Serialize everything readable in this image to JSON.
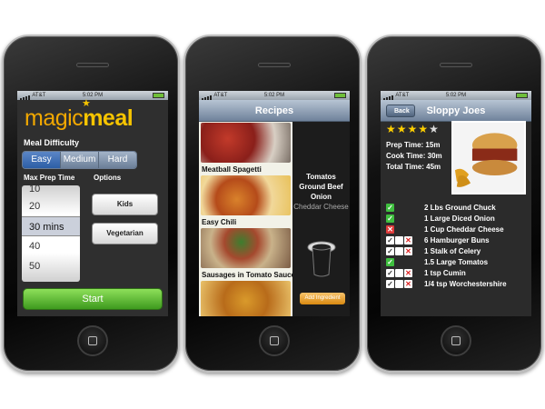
{
  "status": {
    "carrier": "AT&T",
    "time": "5:02 PM"
  },
  "screen1": {
    "logo_part1": "magic",
    "logo_part2": "meal",
    "difficulty_label": "Meal Difficulty",
    "difficulty_options": [
      "Easy",
      "Medium",
      "Hard"
    ],
    "difficulty_selected": "Easy",
    "prep_label": "Max Prep Time",
    "prep_values": [
      "10",
      "20",
      "30 mins",
      "40",
      "50"
    ],
    "prep_selected": "30 mins",
    "options_label": "Options",
    "option_kids": "Kids",
    "option_vegetarian": "Vegetarian",
    "start_label": "Start"
  },
  "screen2": {
    "title": "Recipes",
    "recipes": [
      "Meatball Spagetti",
      "Easy Chili",
      "Sausages in Tomato Sauce",
      ""
    ],
    "ingredients": [
      "Tomatos",
      "Ground Beef",
      "Onion",
      "Cheddar Cheese"
    ],
    "add_button": "Add Ingredient"
  },
  "screen3": {
    "back_label": "Back",
    "title": "Sloppy Joes",
    "rating": 4,
    "rating_max": 5,
    "prep_time": "Prep Time: 15m",
    "cook_time": "Cook Time: 30m",
    "total_time": "Total Time: 45m",
    "ingredients": [
      {
        "name": "2 Lbs Ground Chuck",
        "marks": "check"
      },
      {
        "name": "1 Large Diced Onion",
        "marks": "check"
      },
      {
        "name": "1 Cup Cheddar Cheese",
        "marks": "x"
      },
      {
        "name": "6 Hamburger Buns",
        "marks": "three"
      },
      {
        "name": "1 Stalk of Celery",
        "marks": "three"
      },
      {
        "name": "1.5 Large Tomatos",
        "marks": "check"
      },
      {
        "name": "1 tsp Cumin",
        "marks": "three"
      },
      {
        "name": "1/4 tsp Worchestershire",
        "marks": "three"
      }
    ]
  }
}
